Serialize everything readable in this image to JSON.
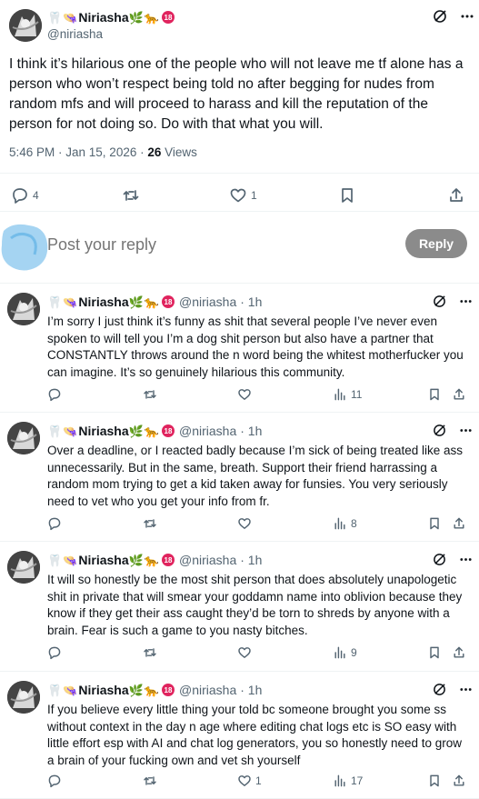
{
  "post": {
    "display_name": "Niriasha",
    "handle": "@niriasha",
    "text": "I think it’s hilarious one of the people who will not leave me tf alone has a person who won’t respect being told no after begging for nudes from random mfs and will proceed to harass and kill the reputation of the person for not doing so. Do with that what you will.",
    "time": "5:46 PM · Jan 15, 2026 ·",
    "views_count": "26",
    "views_label": "Views",
    "reply_count": "4",
    "retweet_count": "",
    "like_count": "1"
  },
  "reply_box": {
    "placeholder": "Post your reply",
    "button_label": "Reply"
  },
  "replies": [
    {
      "display_name": "Niriasha",
      "handle": "@niriasha",
      "time": "· 1h",
      "text": "I’m sorry I just think it’s funny as shit that several people I’ve never even spoken to will tell you I’m a dog shit person but also have a partner that CONSTANTLY throws around the n word being the whitest motherfucker you can imagine. It’s so genuinely hilarious this community.",
      "reply_count": "",
      "retweet_count": "",
      "like_count": "",
      "views": "11"
    },
    {
      "display_name": "Niriasha",
      "handle": "@niriasha",
      "time": "· 1h",
      "text": "Over a deadline, or I reacted badly because I’m sick of being treated like ass unnecessarily. But in the same, breath. Support their friend harrassing a random mom trying to get a kid taken away for funsies. You very seriously need to vet who you get your info from fr.",
      "reply_count": "",
      "retweet_count": "",
      "like_count": "",
      "views": "8"
    },
    {
      "display_name": "Niriasha",
      "handle": "@niriasha",
      "time": "· 1h",
      "text": "It will so honestly be the most shit person that does absolutely unapologetic shit in private that will smear your goddamn name into oblivion because they know if they get their ass caught they’d be torn to shreds by anyone with a brain. Fear is such a game to you nasty bitches.",
      "reply_count": "",
      "retweet_count": "",
      "like_count": "",
      "views": "9"
    },
    {
      "display_name": "Niriasha",
      "handle": "@niriasha",
      "time": "· 1h",
      "text": "If you believe every little thing your told bc someone brought you some ss without context in the day n age where editing chat logs etc is SO easy with little effort esp with AI and chat log generators, you so honestly need to grow a brain of your fucking own and vet sh yourself",
      "reply_count": "",
      "retweet_count": "",
      "like_count": "1",
      "views": "17"
    }
  ],
  "name_emojis": {
    "tooth": "🦷",
    "hat": "👒",
    "herb": "🌿",
    "tiger": "🐆",
    "badge": "18"
  },
  "colors": {
    "text": "#0f1419",
    "muted": "#536471",
    "divider": "#eff3f4",
    "reply_button": "#8b8b8b",
    "badge": "#e0245e"
  },
  "icons": [
    "grok-icon",
    "more-icon",
    "reply-icon",
    "retweet-icon",
    "like-icon",
    "bookmark-icon",
    "share-icon",
    "views-icon"
  ]
}
